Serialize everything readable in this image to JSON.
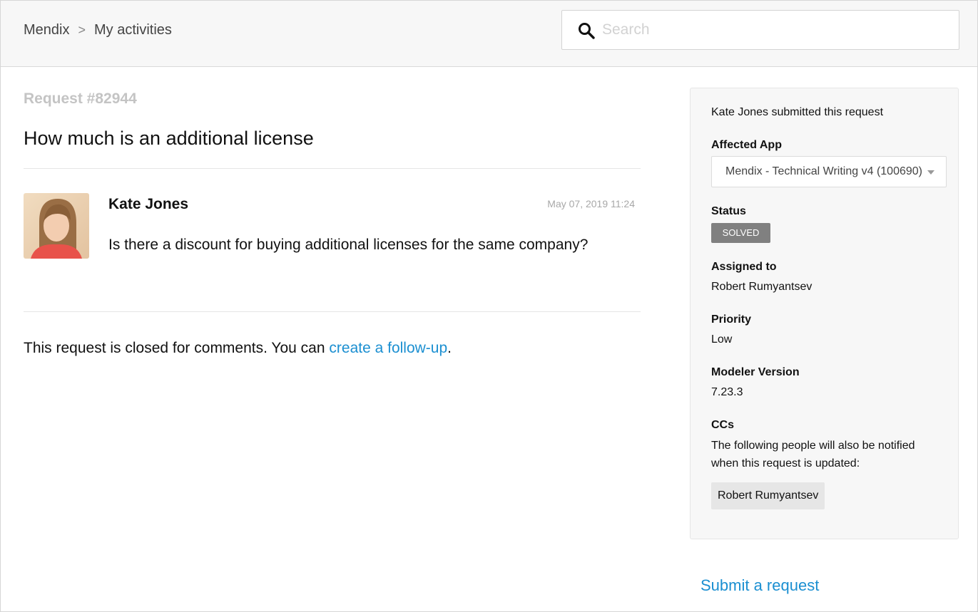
{
  "header": {
    "breadcrumb": [
      {
        "label": "Mendix"
      },
      {
        "label": "My activities"
      }
    ],
    "breadcrumb_separator": ">",
    "search": {
      "placeholder": "Search",
      "value": ""
    }
  },
  "request": {
    "number": "Request #82944",
    "title": "How much is an additional license",
    "post": {
      "author": "Kate Jones",
      "timestamp": "May 07, 2019 11:24",
      "body": "Is there a discount for buying additional licenses for the same company?"
    },
    "closed_note_prefix": "This request is closed for comments. You can ",
    "closed_note_link": "create a follow-up",
    "closed_note_suffix": "."
  },
  "sidebar": {
    "submitted_text": "Kate Jones submitted this request",
    "affected_app_label": "Affected App",
    "affected_app_value": "Mendix - Technical Writing v4 (100690)",
    "status_label": "Status",
    "status_value": "SOLVED",
    "assigned_label": "Assigned to",
    "assigned_value": "Robert Rumyantsev",
    "priority_label": "Priority",
    "priority_value": "Low",
    "modeler_label": "Modeler Version",
    "modeler_value": "7.23.3",
    "ccs_label": "CCs",
    "ccs_text": "The following people will also be notified when this request is updated:",
    "cc_chip": "Robert Rumyantsev"
  },
  "footer": {
    "submit_link": "Submit a request"
  },
  "colors": {
    "link": "#1b8fd1",
    "status_badge": "#808080",
    "header_bg": "#f7f7f7"
  },
  "icons": {
    "search": "search-icon",
    "avatar": "user-avatar-photo",
    "dropdown": "chevron-down-icon"
  }
}
